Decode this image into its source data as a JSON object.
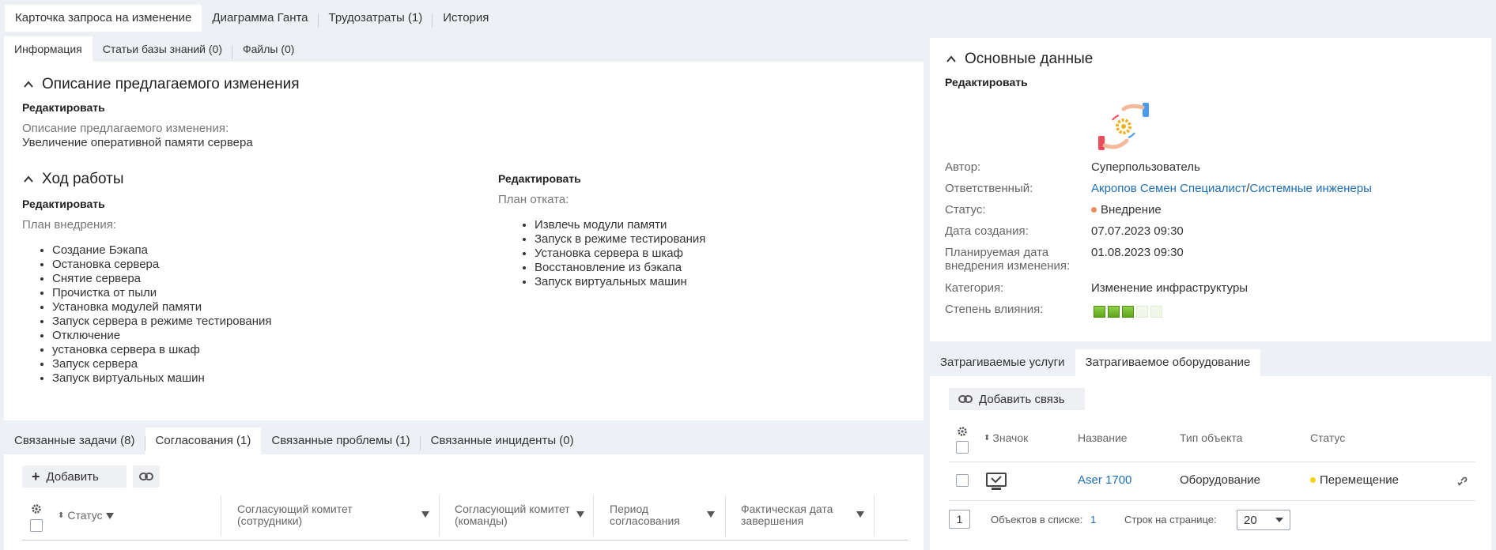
{
  "top_tabs": [
    "Карточка запроса на изменение",
    "Диаграмма Ганта",
    "Трудозатраты (1)",
    "История"
  ],
  "left_tabs": [
    "Информация",
    "Статьи базы знаний (0)",
    "Файлы (0)"
  ],
  "description": {
    "title": "Описание предлагаемого изменения",
    "edit": "Редактировать",
    "label": "Описание предлагаемого изменения:",
    "text": "Увеличение оперативной памяти сервера"
  },
  "workflow": {
    "title": "Ход работы",
    "edit_left": "Редактировать",
    "plan_label": "План внедрения:",
    "plan_items": [
      "Создание Бэкапа",
      "Остановка сервера",
      "Снятие сервера",
      "Прочистка от пыли",
      "Установка модулей памяти",
      "Запуск сервера в режиме тестирования",
      "Отключение",
      "установка сервера в шкаф",
      "Запуск сервера",
      "Запуск виртуальных машин"
    ],
    "edit_right": "Редактировать",
    "rollback_label": "План отката:",
    "rollback_items": [
      "Извлечь модули памяти",
      "Запуск в режиме тестирования",
      "Установка сервера в шкаф",
      "Восстановление из бэкапа",
      "Запуск виртуальных машин"
    ]
  },
  "bottom_tabs": [
    "Связанные задачи (8)",
    "Согласования (1)",
    "Связанные проблемы (1)",
    "Связанные инциденты (0)"
  ],
  "approvals": {
    "add_label": "Добавить",
    "columns": [
      "Статус",
      "Согласующий комитет (сотрудники)",
      "Согласующий комитет (команды)",
      "Период согласования",
      "Фактическая дата завершения"
    ]
  },
  "main_data": {
    "title": "Основные данные",
    "edit": "Редактировать",
    "fields": [
      {
        "label": "Автор:",
        "value": "Суперпользователь"
      },
      {
        "label": "Ответственный:",
        "value": "Акропов Семен Специалист",
        "value2": "Системные инженеры"
      },
      {
        "label": "Статус:",
        "value": "Внедрение"
      },
      {
        "label": "Дата создания:",
        "value": "07.07.2023 09:30"
      },
      {
        "label": "Планируемая дата внедрения изменения:",
        "value": "01.08.2023 09:30"
      },
      {
        "label": "Категория:",
        "value": "Изменение инфраструктуры"
      },
      {
        "label": "Степень влияния:",
        "value": ""
      }
    ],
    "impact_level": 3,
    "impact_max": 5
  },
  "right_tabs": [
    "Затрагиваемые услуги",
    "Затрагиваемое оборудование"
  ],
  "equipment": {
    "add_link": "Добавить связь",
    "columns": [
      "Значок",
      "Название",
      "Тип объекта",
      "Статус"
    ],
    "row": {
      "name": "Aser 1700",
      "type": "Оборудование",
      "status": "Перемещение"
    },
    "page": "1",
    "count_label": "Объектов в списке:",
    "count_value": "1",
    "per_page_label": "Строк на странице:",
    "per_page_value": "20"
  },
  "colors": {
    "link": "#1f6fb5",
    "status_orange": "#f08a5d",
    "status_yellow": "#f5d20a",
    "impact_green": "#5fa51a"
  }
}
